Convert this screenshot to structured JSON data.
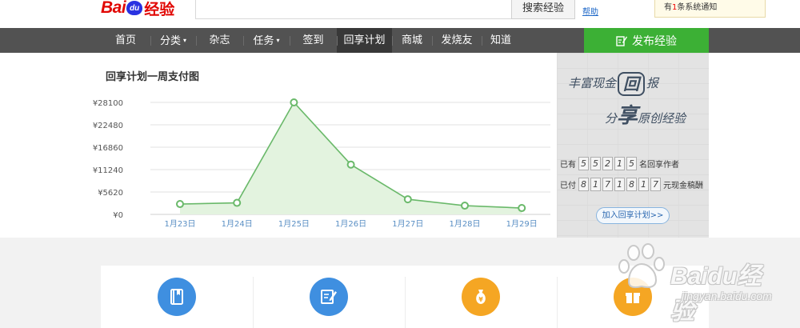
{
  "header": {
    "logo_bai": "Bai",
    "logo_du": "du",
    "logo_jingyan": "经验",
    "search_button": "搜索经验",
    "help_link": "帮助",
    "notice_prefix": "有",
    "notice_count": "1",
    "notice_suffix": "条系统通知"
  },
  "nav": {
    "items": [
      {
        "label": "首页",
        "caret": false
      },
      {
        "label": "分类",
        "caret": true
      },
      {
        "label": "杂志",
        "caret": false
      },
      {
        "label": "任务",
        "caret": true
      },
      {
        "label": "签到",
        "caret": false
      },
      {
        "label": "回享计划",
        "caret": false,
        "active": true
      },
      {
        "label": "商城",
        "caret": false
      },
      {
        "label": "发烧友",
        "caret": false
      },
      {
        "label": "知道",
        "caret": false
      }
    ],
    "publish_label": "发布经验"
  },
  "chart_title": "回享计划一周支付图",
  "chart_data": {
    "type": "area",
    "title": "回享计划一周支付图",
    "categories": [
      "1月23日",
      "1月24日",
      "1月25日",
      "1月26日",
      "1月27日",
      "1月28日",
      "1月29日"
    ],
    "values": [
      2600,
      2900,
      28100,
      12500,
      3800,
      2200,
      1600
    ],
    "y_ticks": [
      "¥0",
      "¥5620",
      "¥11240",
      "¥16860",
      "¥22480",
      "¥28100"
    ],
    "y_tick_values": [
      0,
      5620,
      11240,
      16860,
      22480,
      28100
    ],
    "ylim": [
      0,
      28100
    ],
    "grid": true,
    "line_color": "#6ab96a",
    "fill_color": "#e3f3df"
  },
  "promo": {
    "slogan_line1_pre": "丰富现金",
    "slogan_line1_big": "回",
    "slogan_line1_post": "报",
    "slogan_line2_pre": "分",
    "slogan_line2_big": "享",
    "slogan_line2_post": "原创经验",
    "authors_pre": "已有",
    "authors_digits": [
      "5",
      "5",
      "2",
      "1",
      "5"
    ],
    "authors_post": "名回享作者",
    "paid_pre": "已付",
    "paid_digits": [
      "8",
      "1",
      "7",
      "1",
      "8",
      "1",
      "7"
    ],
    "paid_post": "元现金稿酬",
    "join_button": "加入回享计划>>"
  },
  "cards": [
    {
      "icon": "book-icon",
      "color": "#3f8fe0"
    },
    {
      "icon": "edit-icon",
      "color": "#3f8fe0"
    },
    {
      "icon": "money-bag-icon",
      "color": "#f5a623"
    },
    {
      "icon": "gift-icon",
      "color": "#f5a623"
    }
  ],
  "watermark": {
    "text": "Baidu经验",
    "url": "jingyan.baidu.com"
  }
}
